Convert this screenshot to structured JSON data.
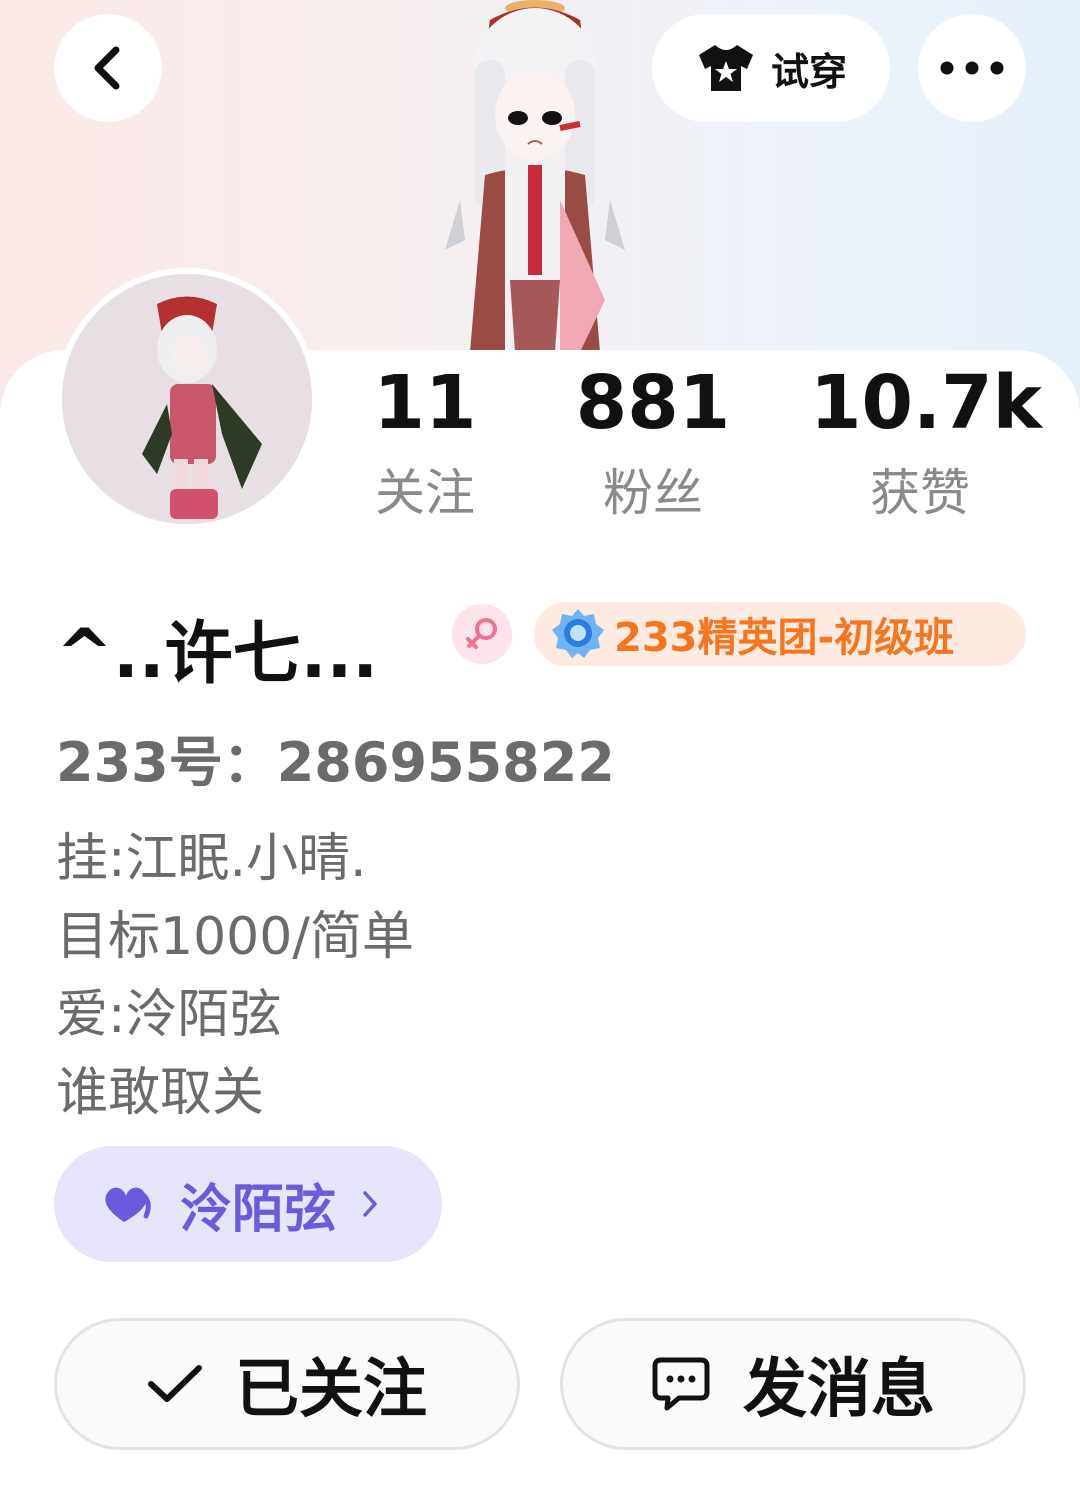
{
  "header": {
    "try_on_label": "试穿"
  },
  "stats": [
    {
      "value": "11",
      "label": "关注"
    },
    {
      "value": "881",
      "label": "粉丝"
    },
    {
      "value": "10.7k",
      "label": "获赞"
    }
  ],
  "profile": {
    "name": "^..许七...",
    "gender_icon": "female-icon",
    "rank_badge": "233精英团-初级班",
    "uid_text": "233号：286955822",
    "bio_lines": [
      "挂:江眠.小晴.",
      "目标1000/简单",
      "爱:泠陌弦",
      "谁敢取关"
    ],
    "tag": {
      "label": "泠陌弦",
      "icon": "heart-icon"
    }
  },
  "actions": {
    "follow_label": "已关注",
    "message_label": "发消息"
  },
  "colors": {
    "rank_text": "#f5761f",
    "tag_text": "#6a5bdc",
    "tag_bg": "#e7e5fb",
    "stat_label": "#8a8a8a"
  }
}
